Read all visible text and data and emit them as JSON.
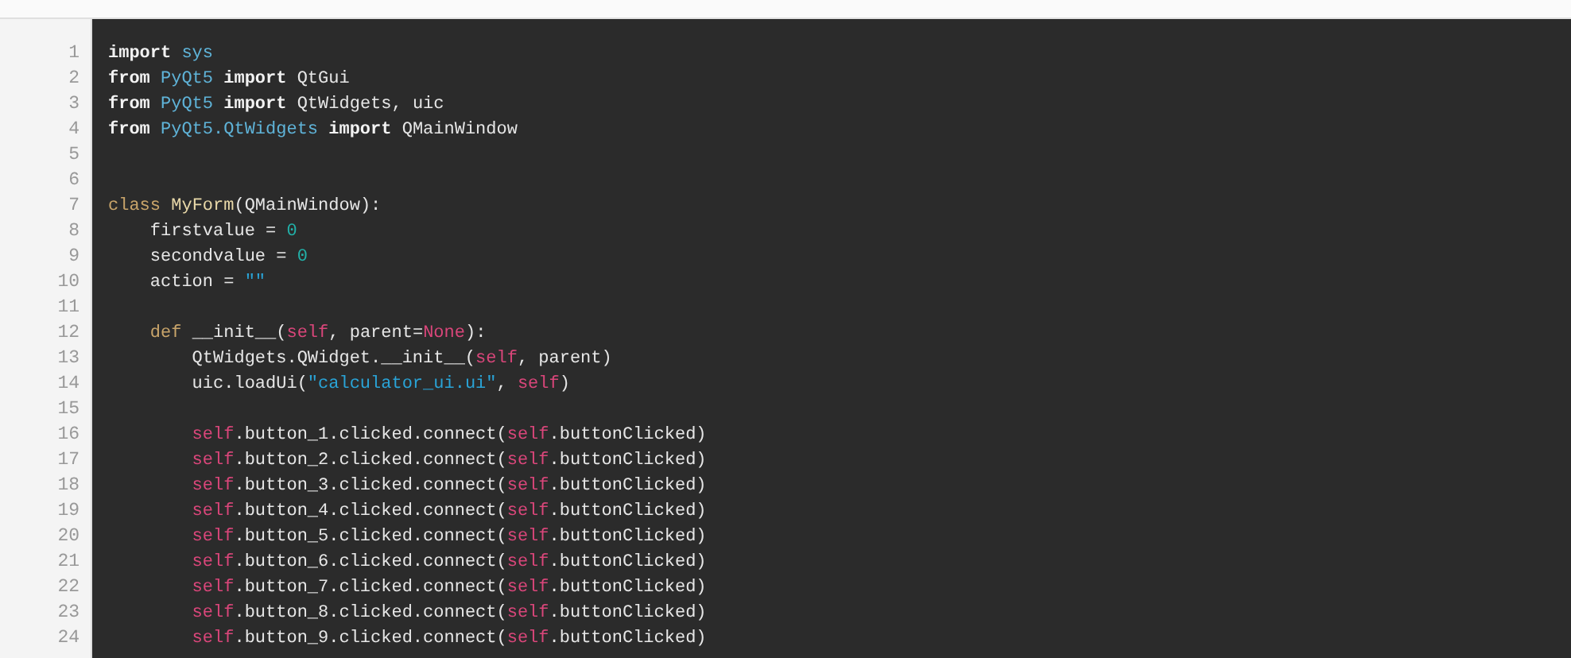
{
  "code_lines": [
    {
      "number": "1",
      "tokens": [
        {
          "text": "import",
          "kind": "keyword"
        },
        {
          "text": " sys",
          "kind": "module"
        }
      ]
    },
    {
      "number": "2",
      "tokens": [
        {
          "text": "from",
          "kind": "keyword"
        },
        {
          "text": " PyQt5",
          "kind": "module"
        },
        {
          "text": " import",
          "kind": "keyword"
        },
        {
          "text": " QtGui"
        }
      ]
    },
    {
      "number": "3",
      "tokens": [
        {
          "text": "from",
          "kind": "keyword"
        },
        {
          "text": " PyQt5",
          "kind": "module"
        },
        {
          "text": " import",
          "kind": "keyword"
        },
        {
          "text": " QtWidgets, uic"
        }
      ]
    },
    {
      "number": "4",
      "tokens": [
        {
          "text": "from",
          "kind": "keyword"
        },
        {
          "text": " PyQt5.QtWidgets",
          "kind": "module"
        },
        {
          "text": " import",
          "kind": "keyword"
        },
        {
          "text": " QMainWindow"
        }
      ]
    },
    {
      "number": "5"
    },
    {
      "number": "6"
    },
    {
      "number": "7",
      "tokens": [
        {
          "text": "class",
          "kind": "declaration"
        },
        {
          "text": " MyForm",
          "kind": "name"
        },
        {
          "text": "(QMainWindow):"
        }
      ]
    },
    {
      "number": "8",
      "tokens": [
        {
          "text": "    firstvalue = "
        },
        {
          "text": "0",
          "kind": "number"
        }
      ]
    },
    {
      "number": "9",
      "tokens": [
        {
          "text": "    secondvalue = "
        },
        {
          "text": "0",
          "kind": "number"
        }
      ]
    },
    {
      "number": "10",
      "tokens": [
        {
          "text": "    action = "
        },
        {
          "text": "\"\"",
          "kind": "string"
        }
      ]
    },
    {
      "number": "11"
    },
    {
      "number": "12",
      "tokens": [
        {
          "text": "    def",
          "kind": "declaration"
        },
        {
          "text": " __init__("
        },
        {
          "text": "self",
          "kind": "self"
        },
        {
          "text": ", parent="
        },
        {
          "text": "None",
          "kind": "self"
        },
        {
          "text": "):"
        }
      ]
    },
    {
      "number": "13",
      "tokens": [
        {
          "text": "        QtWidgets.QWidget.__init__("
        },
        {
          "text": "self",
          "kind": "self"
        },
        {
          "text": ", parent)"
        }
      ]
    },
    {
      "number": "14",
      "tokens": [
        {
          "text": "        uic.loadUi("
        },
        {
          "text": "\"calculator_ui.ui\"",
          "kind": "string"
        },
        {
          "text": ", "
        },
        {
          "text": "self",
          "kind": "self"
        },
        {
          "text": ")"
        }
      ]
    },
    {
      "number": "15"
    },
    {
      "number": "16",
      "tokens": [
        {
          "text": "        self",
          "kind": "self"
        },
        {
          "text": ".button_1.clicked.connect("
        },
        {
          "text": "self",
          "kind": "self"
        },
        {
          "text": ".buttonClicked)"
        }
      ]
    },
    {
      "number": "17",
      "tokens": [
        {
          "text": "        self",
          "kind": "self"
        },
        {
          "text": ".button_2.clicked.connect("
        },
        {
          "text": "self",
          "kind": "self"
        },
        {
          "text": ".buttonClicked)"
        }
      ]
    },
    {
      "number": "18",
      "tokens": [
        {
          "text": "        self",
          "kind": "self"
        },
        {
          "text": ".button_3.clicked.connect("
        },
        {
          "text": "self",
          "kind": "self"
        },
        {
          "text": ".buttonClicked)"
        }
      ]
    },
    {
      "number": "19",
      "tokens": [
        {
          "text": "        self",
          "kind": "self"
        },
        {
          "text": ".button_4.clicked.connect("
        },
        {
          "text": "self",
          "kind": "self"
        },
        {
          "text": ".buttonClicked)"
        }
      ]
    },
    {
      "number": "20",
      "tokens": [
        {
          "text": "        self",
          "kind": "self"
        },
        {
          "text": ".button_5.clicked.connect("
        },
        {
          "text": "self",
          "kind": "self"
        },
        {
          "text": ".buttonClicked)"
        }
      ]
    },
    {
      "number": "21",
      "tokens": [
        {
          "text": "        self",
          "kind": "self"
        },
        {
          "text": ".button_6.clicked.connect("
        },
        {
          "text": "self",
          "kind": "self"
        },
        {
          "text": ".buttonClicked)"
        }
      ]
    },
    {
      "number": "22",
      "tokens": [
        {
          "text": "        self",
          "kind": "self"
        },
        {
          "text": ".button_7.clicked.connect("
        },
        {
          "text": "self",
          "kind": "self"
        },
        {
          "text": ".buttonClicked)"
        }
      ]
    },
    {
      "number": "23",
      "tokens": [
        {
          "text": "        self",
          "kind": "self"
        },
        {
          "text": ".button_8.clicked.connect("
        },
        {
          "text": "self",
          "kind": "self"
        },
        {
          "text": ".buttonClicked)"
        }
      ]
    },
    {
      "number": "24",
      "tokens": [
        {
          "text": "        self",
          "kind": "self"
        },
        {
          "text": ".button_9.clicked.connect("
        },
        {
          "text": "self",
          "kind": "self"
        },
        {
          "text": ".buttonClicked)"
        }
      ]
    }
  ]
}
